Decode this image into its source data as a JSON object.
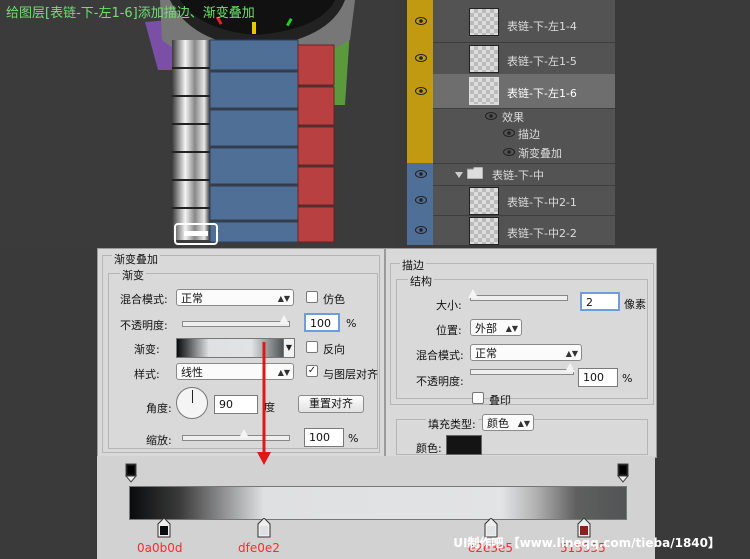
{
  "caption": "给图层[表链-下-左1-6]添加描边、渐变叠加",
  "layers": {
    "rows": [
      {
        "name": "表链-下-左1-4"
      },
      {
        "name": "表链-下-左1-5"
      },
      {
        "name": "表链-下-左1-6"
      },
      {
        "name": "表链-下-中"
      },
      {
        "name": "表链-下-中2-1"
      },
      {
        "name": "表链-下-中2-2"
      }
    ],
    "effects_label": "效果",
    "effect_items": [
      "描边",
      "渐变叠加"
    ],
    "colors": {
      "yellow": "#c29a12",
      "blue": "#4f6f97"
    }
  },
  "gradient_overlay": {
    "title": "渐变叠加",
    "group": "渐变",
    "blend_mode_label": "混合模式:",
    "blend_mode": "正常",
    "dither_label": "仿色",
    "opacity_label": "不透明度:",
    "opacity": "100",
    "percent": "%",
    "gradient_label": "渐变:",
    "reverse_label": "反向",
    "style_label": "样式:",
    "style": "线性",
    "align_label": "与图层对齐",
    "angle_label": "角度:",
    "angle": "90",
    "degree": "度",
    "reset_button": "重置对齐",
    "scale_label": "缩放:",
    "scale": "100"
  },
  "stroke": {
    "title": "描边",
    "group": "结构",
    "size_label": "大小:",
    "size": "2",
    "px": "像素",
    "position_label": "位置:",
    "position": "外部",
    "blend_mode_label": "混合模式:",
    "blend_mode": "正常",
    "opacity_label": "不透明度:",
    "opacity": "100",
    "percent": "%",
    "emboss_label": "叠印",
    "fill_type_label": "填充类型:",
    "fill_type": "颜色",
    "color_label": "颜色:",
    "color": "#141414"
  },
  "gradient_stops": [
    {
      "label": "0a0b0d",
      "color": "#0a0b0d"
    },
    {
      "label": "dfe0e2",
      "color": "#dfe0e2"
    },
    {
      "label": "e2e3e5",
      "color": "#e2e3e5"
    },
    {
      "label": "515555",
      "color": "#515555"
    }
  ],
  "watermark": "UI制作吧 【www.lineqq.com/tieba/1840】"
}
